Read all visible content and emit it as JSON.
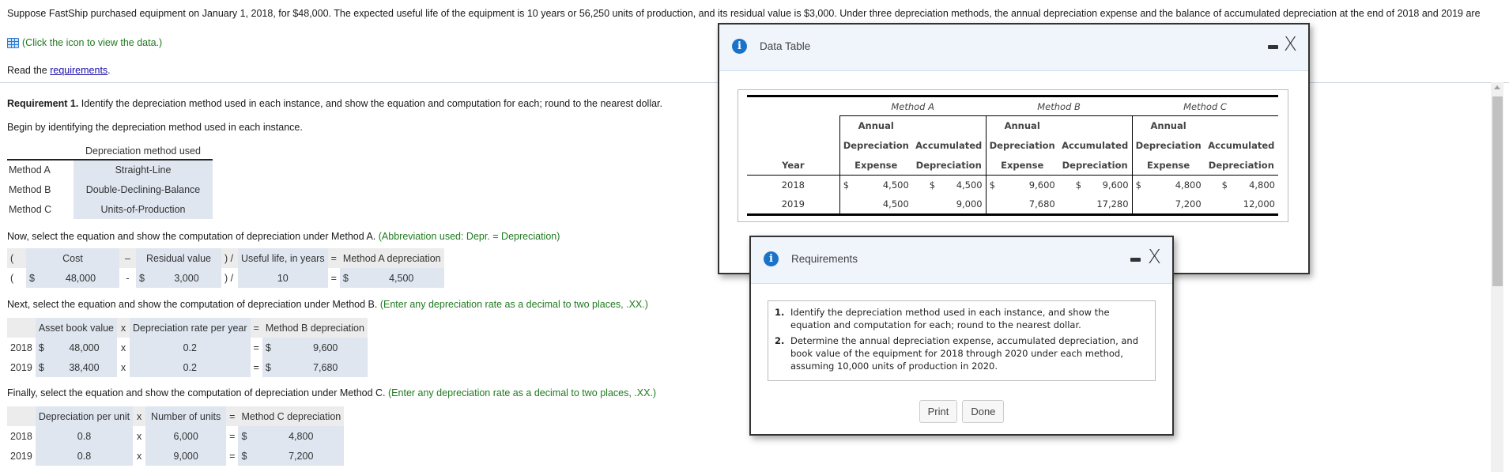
{
  "problem": {
    "intro": "Suppose FastShip purchased equipment on January 1, 2018, for $48,000. The expected useful life of the equipment is 10 years or 56,250 units of production, and its residual value is $3,000. Under three depreciation methods, the annual depreciation expense and the balance of accumulated depreciation at the end of 2018 and 2019 are",
    "data_link": "(Click the icon to view the data.)",
    "read_prefix": "Read the ",
    "read_link": "requirements",
    "read_suffix": "."
  },
  "requirement1": {
    "label": "Requirement 1.",
    "text": " Identify the depreciation method used in each instance, and show the equation and computation for each; round to the nearest dollar.",
    "begin": "Begin by identifying the depreciation method used in each instance."
  },
  "methods_table": {
    "header": "Depreciation method used",
    "rows": [
      {
        "label": "Method A",
        "value": "Straight-Line"
      },
      {
        "label": "Method B",
        "value": "Double-Declining-Balance"
      },
      {
        "label": "Method C",
        "value": "Units-of-Production"
      }
    ]
  },
  "method_a": {
    "instruction": "Now, select the equation and show the computation of depreciation under Method A.",
    "hint": " (Abbreviation used: Depr. = Depreciation)",
    "headers": {
      "open": "(",
      "cost": "Cost",
      "minus": "–",
      "residual": "Residual value",
      "close_div": ") /",
      "life": "Useful life, in years",
      "eq": "=",
      "result": "Method A depreciation"
    },
    "row": {
      "open": "(",
      "cost_dollar": "$",
      "cost": "48,000",
      "minus": "-",
      "residual_dollar": "$",
      "residual": "3,000",
      "close_div": ") /",
      "life": "10",
      "eq": "=",
      "result_dollar": "$",
      "result": "4,500"
    }
  },
  "method_b": {
    "instruction": "Next, select the equation and show the computation of depreciation under Method B.",
    "hint": " (Enter any depreciation rate as a decimal to two places, .XX.)",
    "headers": {
      "book": "Asset book value",
      "times": "x",
      "rate": "Depreciation rate per year",
      "eq": "=",
      "result": "Method B depreciation"
    },
    "rows": [
      {
        "year": "2018",
        "book_dollar": "$",
        "book": "48,000",
        "times": "x",
        "rate": "0.2",
        "eq": "=",
        "result_dollar": "$",
        "result": "9,600"
      },
      {
        "year": "2019",
        "book_dollar": "$",
        "book": "38,400",
        "times": "x",
        "rate": "0.2",
        "eq": "=",
        "result_dollar": "$",
        "result": "7,680"
      }
    ]
  },
  "method_c": {
    "instruction": "Finally, select the equation and show the computation of depreciation under Method C.",
    "hint": " (Enter any depreciation rate as a decimal to two places, .XX.)",
    "headers": {
      "per_unit": "Depreciation per unit",
      "times": "x",
      "units": "Number of units",
      "eq": "=",
      "result": "Method C depreciation"
    },
    "rows": [
      {
        "year": "2018",
        "per_unit": "0.8",
        "times": "x",
        "units": "6,000",
        "eq": "=",
        "result_dollar": "$",
        "result": "4,800"
      },
      {
        "year": "2019",
        "per_unit": "0.8",
        "times": "x",
        "units": "9,000",
        "eq": "=",
        "result_dollar": "$",
        "result": "7,200"
      }
    ]
  },
  "data_dialog": {
    "title": "Data Table",
    "close": "X",
    "methods": [
      "Method A",
      "Method B",
      "Method C"
    ],
    "col_line1": "Annual",
    "col_line2a": "Depreciation",
    "col_line2b": "Accumulated",
    "col_line3a": "Expense",
    "col_line3b": "Depreciation",
    "year_header": "Year",
    "dollar": "$",
    "rows": [
      {
        "year": "2018",
        "a_exp": "4,500",
        "a_acc": "4,500",
        "b_exp": "9,600",
        "b_acc": "9,600",
        "c_exp": "4,800",
        "c_acc": "4,800"
      },
      {
        "year": "2019",
        "a_exp": "4,500",
        "a_acc": "9,000",
        "b_exp": "7,680",
        "b_acc": "17,280",
        "c_exp": "7,200",
        "c_acc": "12,000"
      }
    ]
  },
  "req_dialog": {
    "title": "Requirements",
    "close": "X",
    "items": [
      {
        "num": "1.",
        "text": "Identify the depreciation method used in each instance, and show the equation and computation for each; round to the nearest dollar."
      },
      {
        "num": "2.",
        "text": "Determine the annual depreciation expense, accumulated depreciation, and book value of the equipment for 2018 through 2020 under each method, assuming 10,000 units of production in 2020."
      }
    ],
    "print_label": "Print",
    "done_label": "Done"
  }
}
